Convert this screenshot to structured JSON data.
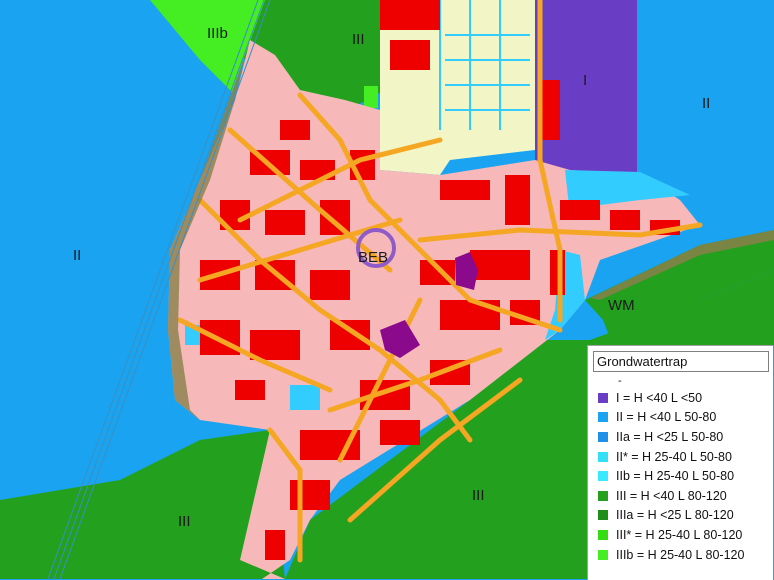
{
  "map": {
    "zone_labels": {
      "IIIb": "IIIb",
      "III_top": "III",
      "I": "I",
      "II_right": "II",
      "II_left": "II",
      "BEB": "BEB",
      "WM": "WM",
      "III_bottom_center": "III",
      "III_bottom_left": "III"
    },
    "colors": {
      "zone_I": "#6a3ec4",
      "zone_II": "#1aa3f0",
      "zone_III": "#22a01e",
      "zone_IIIb": "#44ee22",
      "urban_fill": "#f6b8b8",
      "buildings": "#ee0000",
      "roads": "#f5a623",
      "special_buildings": "#8b0a8b",
      "open_land": "#f2f5c6",
      "water": "#33ccff",
      "marker_circle": "#8e5bc8"
    }
  },
  "legend": {
    "title": "Grondwatertrap",
    "dash": "-",
    "items": [
      {
        "label": "I =  H <40  L <50",
        "color": "#6a3ec4"
      },
      {
        "label": "II =  H <40  L 50-80",
        "color": "#1aa3f0"
      },
      {
        "label": "IIa =  H <25  L 50-80",
        "color": "#1e90e8"
      },
      {
        "label": "II* =  H 25-40  L 50-80",
        "color": "#33e0f5"
      },
      {
        "label": "IIb =  H 25-40  L 50-80",
        "color": "#3ae8ff"
      },
      {
        "label": "III =  H <40  L 80-120",
        "color": "#22a01e"
      },
      {
        "label": "IIIa =  H <25  L 80-120",
        "color": "#1f8f1a"
      },
      {
        "label": "III* =  H 25-40  L 80-120",
        "color": "#33dd11"
      },
      {
        "label": "IIIb =  H 25-40  L 80-120",
        "color": "#44ee22"
      }
    ]
  }
}
